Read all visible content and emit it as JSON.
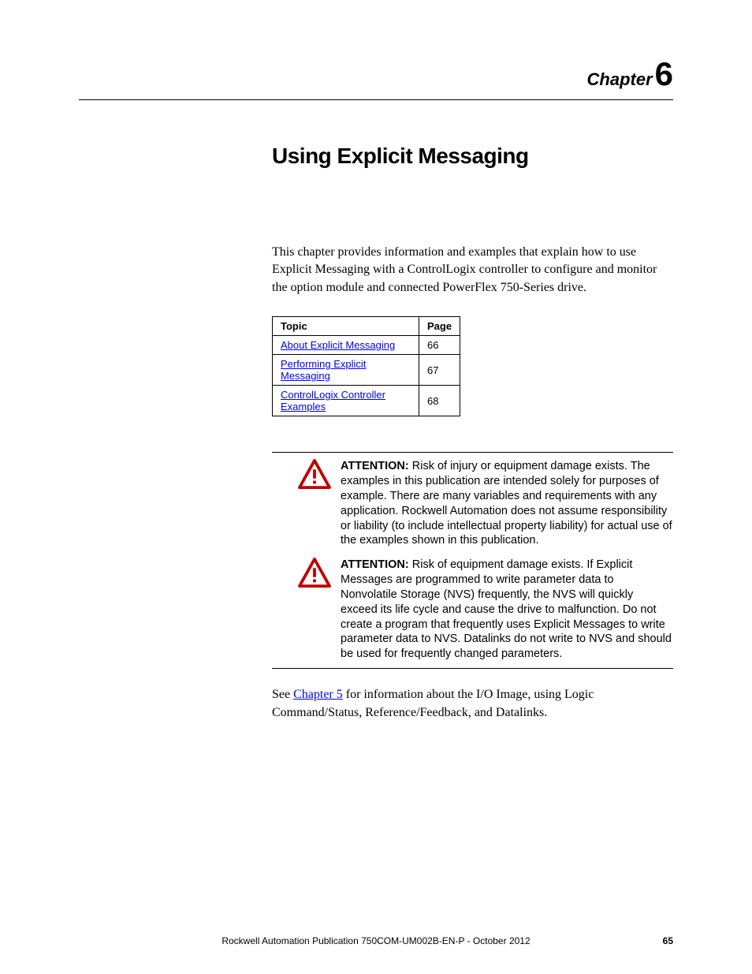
{
  "chapter": {
    "label": "Chapter",
    "number": "6"
  },
  "title": "Using Explicit Messaging",
  "intro": "This chapter provides information and examples that explain how to use Explicit Messaging with a ControlLogix controller to configure and monitor the option module and connected PowerFlex 750-Series drive.",
  "toc": {
    "headers": {
      "topic": "Topic",
      "page": "Page"
    },
    "rows": [
      {
        "topic": "About Explicit Messaging",
        "page": "66"
      },
      {
        "topic": "Performing Explicit Messaging",
        "page": "67"
      },
      {
        "topic": "ControlLogix Controller Examples",
        "page": "68"
      }
    ]
  },
  "attention": [
    {
      "label": "ATTENTION:",
      "body": " Risk of injury or equipment damage exists. The examples in this publication are intended solely for purposes of example. There are many variables and requirements with any application. Rockwell Automation does not assume responsibility or liability (to include intellectual property liability) for actual use of the examples shown in this publication."
    },
    {
      "label": "ATTENTION:",
      "body": " Risk of equipment damage exists. If Explicit Messages are programmed to write parameter data to Nonvolatile Storage (NVS) frequently, the NVS will quickly exceed its life cycle and cause the drive to malfunction. Do not create a program that frequently uses Explicit Messages to write parameter data to NVS. Datalinks do not write to NVS and should be used for frequently changed parameters."
    }
  ],
  "see_ref": {
    "prefix": "See ",
    "link": "Chapter 5",
    "suffix": " for information about the I/O Image, using Logic Command/Status, Reference/Feedback, and Datalinks."
  },
  "footer": {
    "publication": "Rockwell Automation Publication 750COM-UM002B-EN-P - October 2012",
    "page": "65"
  }
}
